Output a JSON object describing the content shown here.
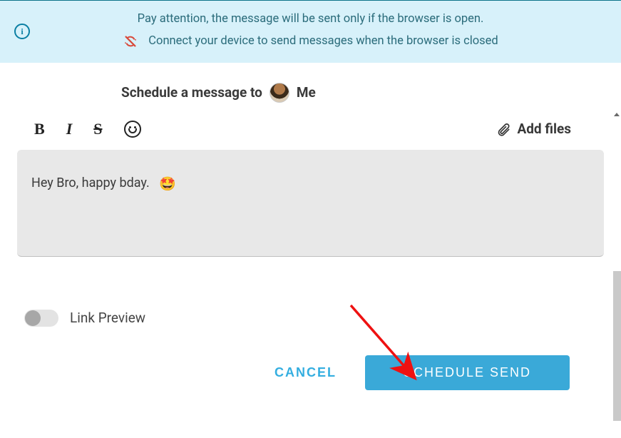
{
  "banner": {
    "line1": "Pay attention, the message will be sent only if the browser is open.",
    "line2": "Connect your device to send messages when the browser is closed"
  },
  "header": {
    "prefix": "Schedule a message to",
    "recipient": "Me"
  },
  "toolbar": {
    "bold": "B",
    "italic": "I",
    "strike": "S",
    "add_files_label": "Add files"
  },
  "composer": {
    "text": "Hey Bro, happy bday.",
    "emoji": "🤩"
  },
  "options": {
    "link_preview_label": "Link Preview",
    "link_preview_on": false
  },
  "actions": {
    "cancel": "CANCEL",
    "send": "SCHEDULE SEND"
  }
}
